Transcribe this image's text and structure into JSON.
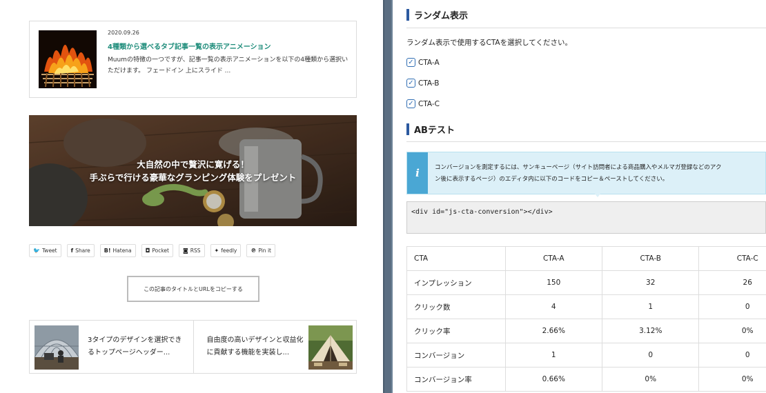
{
  "left": {
    "post": {
      "date": "2020.09.26",
      "title": "4種類から選べるタブ記事一覧の表示アニメーション",
      "excerpt": "Muumの特徴の一つですが、記事一覧の表示アニメーションを以下の4種類から選択いただけます。 フェードイン 上にスライド ..."
    },
    "banner": {
      "line1": "大自然の中で贅沢に寛げる！",
      "line2": "手ぶらで行ける豪華なグランピング体験をプレゼント"
    },
    "share": [
      {
        "icon": "🐦",
        "label": "Tweet"
      },
      {
        "icon": "f",
        "label": "Share"
      },
      {
        "icon": "B!",
        "label": "Hatena"
      },
      {
        "icon": "◘",
        "label": "Pocket"
      },
      {
        "icon": "◙",
        "label": "RSS"
      },
      {
        "icon": "✦",
        "label": "feedly"
      },
      {
        "icon": "℗",
        "label": "Pin it"
      }
    ],
    "copy_button": "この記事のタイトルとURLをコピーする",
    "related": [
      {
        "title": "3タイプのデザインを選択できるトップページヘッダー..."
      },
      {
        "title": "自由度の高いデザインと収益化に貢献する機能を実装し..."
      }
    ]
  },
  "right": {
    "random": {
      "heading": "ランダム表示",
      "description": "ランダム表示で使用するCTAを選択してください。",
      "options": [
        {
          "label": "CTA-A",
          "checked": true
        },
        {
          "label": "CTA-B",
          "checked": true
        },
        {
          "label": "CTA-C",
          "checked": true
        }
      ]
    },
    "ab": {
      "heading": "ABテスト",
      "info_icon": "i",
      "info_line1": "コンバージョンを測定するには、サンキューページ（サイト訪問者による商品購入やメルマガ登録などのアク",
      "info_line2": "ン後に表示するページ）のエディタ内に以下のコードをコピー＆ペーストしてください。",
      "code": "<div id=\"js-cta-conversion\"></div>"
    },
    "table": {
      "header": [
        "CTA",
        "CTA-A",
        "CTA-B",
        "CTA-C"
      ],
      "rows": [
        [
          "インプレッション",
          "150",
          "32",
          "26"
        ],
        [
          "クリック数",
          "4",
          "1",
          "0"
        ],
        [
          "クリック率",
          "2.66%",
          "3.12%",
          "0%"
        ],
        [
          "コンバージョン",
          "1",
          "0",
          "0"
        ],
        [
          "コンバージョン率",
          "0.66%",
          "0%",
          "0%"
        ]
      ]
    }
  }
}
